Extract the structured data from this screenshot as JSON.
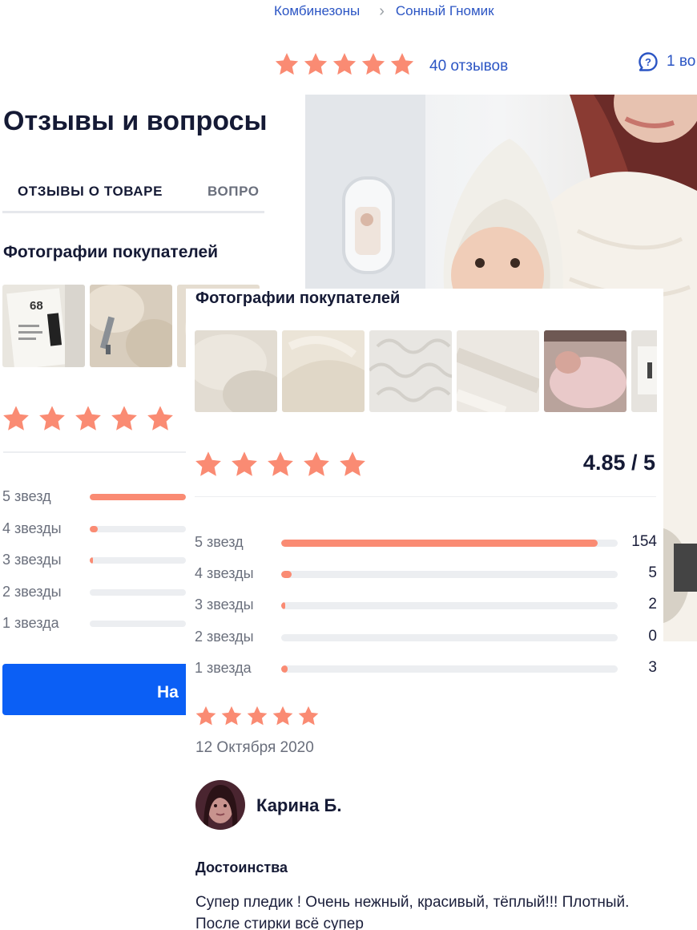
{
  "breadcrumb": {
    "items": [
      "Комбинезоны",
      "Сонный Гномик"
    ],
    "separator": ">"
  },
  "product_rating": {
    "stars": 5,
    "reviews_link": "40 отзывов",
    "questions_link": "1 во",
    "questions_icon": "question-bubble-icon"
  },
  "bg_panel": {
    "title": "Отзывы и вопросы",
    "tabs": [
      {
        "label": "ОТЗЫВЫ О ТОВАРЕ",
        "active": true
      },
      {
        "label": "ВОПРО",
        "active": false
      }
    ],
    "photos_heading": "Фотографии покупателей",
    "photo_label": "68",
    "rows": [
      {
        "label": "5 звезд",
        "fraction": 1.0
      },
      {
        "label": "4 звезды",
        "fraction": 0.08
      },
      {
        "label": "3 звезды",
        "fraction": 0.03
      },
      {
        "label": "2 звезды",
        "fraction": 0
      },
      {
        "label": "1 звезда",
        "fraction": 0
      }
    ],
    "cta_label": "На"
  },
  "reviews_panel": {
    "photos_heading": "Фотографии покупателей",
    "stars": 5,
    "score": "4.85 / 5",
    "distribution": [
      {
        "label": "5 звезд",
        "count": "154",
        "fraction": 0.94
      },
      {
        "label": "4 звезды",
        "count": "5",
        "fraction": 0.03
      },
      {
        "label": "3 звезды",
        "count": "2",
        "fraction": 0.013
      },
      {
        "label": "2 звезды",
        "count": "0",
        "fraction": 0
      },
      {
        "label": "1 звезда",
        "count": "3",
        "fraction": 0.018
      }
    ]
  },
  "review": {
    "stars": 5,
    "date": "12 Октября 2020",
    "author": "Карина Б.",
    "pros_heading": "Достоинства",
    "pros_text": "Супер пледик ! Очень нежный, красивый, тёплый!!! Плотный. После стирки всё супер"
  },
  "colors": {
    "accent_link": "#2b55c4",
    "star": "#fa8b73",
    "bar_fill": "#fa8b73",
    "bar_track": "#eceef1",
    "cta": "#0b5ff5",
    "heading": "#151a35",
    "muted": "#6a6f7c"
  }
}
